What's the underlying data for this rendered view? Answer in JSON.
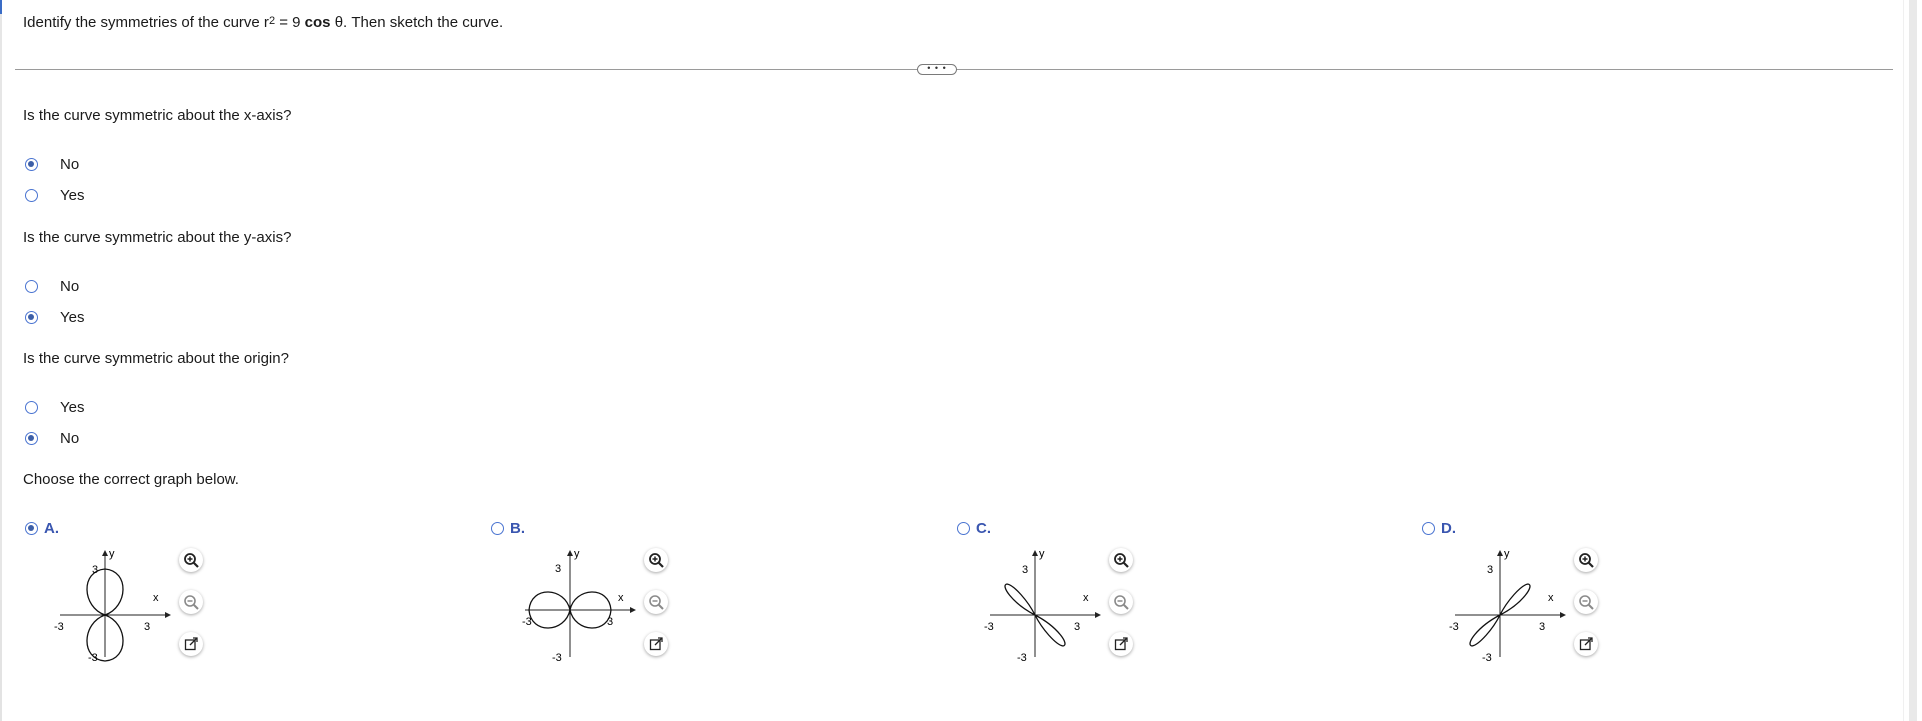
{
  "question": {
    "prefix": "Identify the symmetries of the curve r",
    "exponent": "2",
    "middle": " = 9 ",
    "bold": "cos",
    "suffix": " θ. Then sketch the curve."
  },
  "expand_label": "• • •",
  "q_x": {
    "prompt": "Is the curve symmetric about the x-axis?",
    "options": [
      {
        "label": "No",
        "selected": true
      },
      {
        "label": "Yes",
        "selected": false
      }
    ]
  },
  "q_y": {
    "prompt": "Is the curve symmetric about the y-axis?",
    "options": [
      {
        "label": "No",
        "selected": false
      },
      {
        "label": "Yes",
        "selected": true
      }
    ]
  },
  "q_o": {
    "prompt": "Is the curve symmetric about the origin?",
    "options": [
      {
        "label": "Yes",
        "selected": false
      },
      {
        "label": "No",
        "selected": true
      }
    ]
  },
  "graph_prompt": "Choose the correct graph below.",
  "choices": [
    {
      "label": "A.",
      "selected": true
    },
    {
      "label": "B.",
      "selected": false
    },
    {
      "label": "C.",
      "selected": false
    },
    {
      "label": "D.",
      "selected": false
    }
  ],
  "axis_labels": {
    "x": "x",
    "y": "y",
    "pos": "3",
    "neg": "-3"
  },
  "colors": {
    "accent": "#4a74d1",
    "choice_text": "#3a56b0",
    "divider": "#9a9a9a"
  },
  "icons": [
    "zoom-in-icon",
    "zoom-out-icon",
    "open-in-new-window-icon"
  ]
}
